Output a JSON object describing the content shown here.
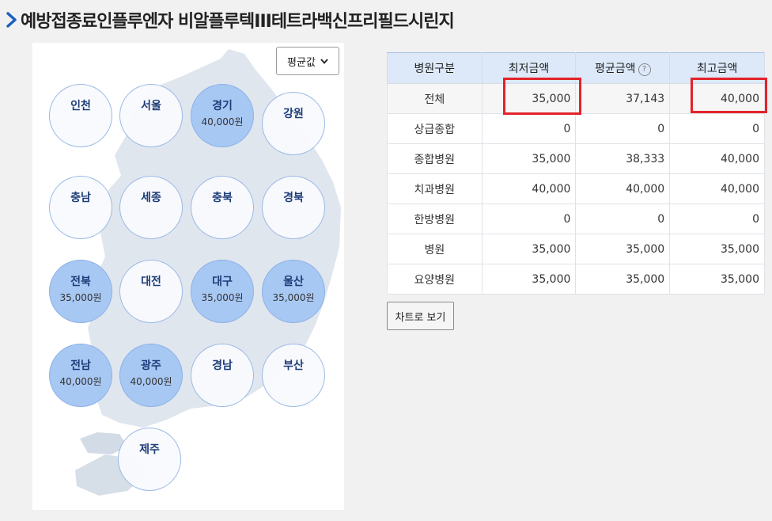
{
  "page": {
    "title": "예방접종료인플루엔자 비알플루텍III테트라백신프리필드시린지"
  },
  "map": {
    "select_value": "평균값",
    "regions": [
      {
        "name": "인천",
        "amount": ""
      },
      {
        "name": "서울",
        "amount": ""
      },
      {
        "name": "경기",
        "amount": "40,000원"
      },
      {
        "name": "강원",
        "amount": ""
      },
      {
        "name": "충남",
        "amount": ""
      },
      {
        "name": "세종",
        "amount": ""
      },
      {
        "name": "충북",
        "amount": ""
      },
      {
        "name": "경북",
        "amount": ""
      },
      {
        "name": "전북",
        "amount": "35,000원"
      },
      {
        "name": "대전",
        "amount": ""
      },
      {
        "name": "대구",
        "amount": "35,000원"
      },
      {
        "name": "울산",
        "amount": "35,000원"
      },
      {
        "name": "전남",
        "amount": "40,000원"
      },
      {
        "name": "광주",
        "amount": "40,000원"
      },
      {
        "name": "경남",
        "amount": ""
      },
      {
        "name": "부산",
        "amount": ""
      },
      {
        "name": "제주",
        "amount": ""
      }
    ]
  },
  "table": {
    "headers": {
      "category": "병원구분",
      "min": "최저금액",
      "avg": "평균금액",
      "max": "최고금액"
    },
    "help_icon": "question-icon",
    "rows": [
      {
        "category": "전체",
        "min": "35,000",
        "avg": "37,143",
        "max": "40,000"
      },
      {
        "category": "상급종합",
        "min": "0",
        "avg": "0",
        "max": "0"
      },
      {
        "category": "종합병원",
        "min": "35,000",
        "avg": "38,333",
        "max": "40,000"
      },
      {
        "category": "치과병원",
        "min": "40,000",
        "avg": "40,000",
        "max": "40,000"
      },
      {
        "category": "한방병원",
        "min": "0",
        "avg": "0",
        "max": "0"
      },
      {
        "category": "병원",
        "min": "35,000",
        "avg": "35,000",
        "max": "35,000"
      },
      {
        "category": "요양병원",
        "min": "35,000",
        "avg": "35,000",
        "max": "35,000"
      }
    ]
  },
  "actions": {
    "chart_button": "차트로 보기"
  },
  "colors": {
    "region_active": "#a8c8f4",
    "header_bg": "#dde9f9",
    "highlight": "#e3232a"
  }
}
